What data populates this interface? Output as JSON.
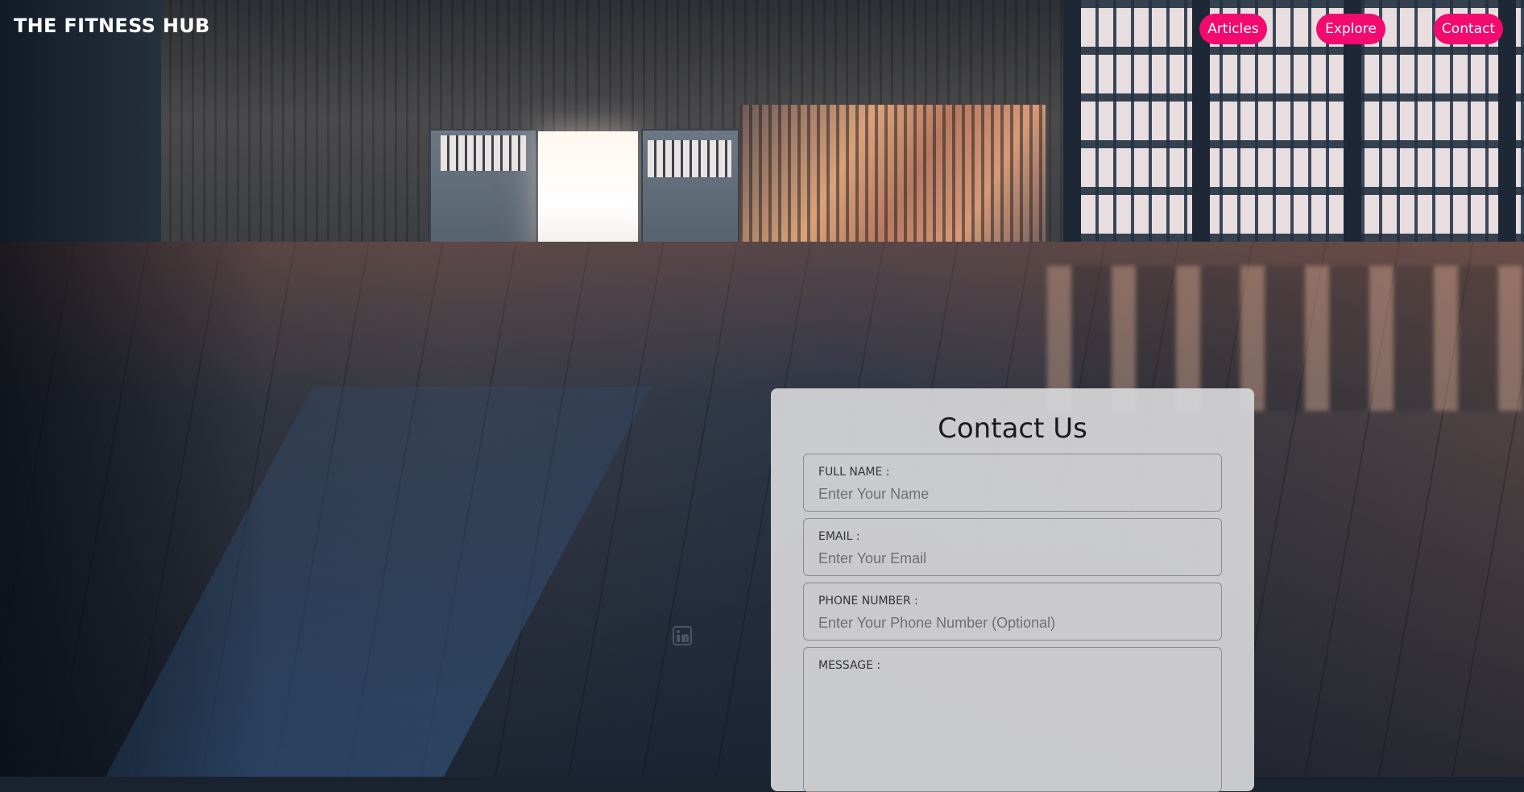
{
  "header": {
    "brand": "THE FITNESS HUB",
    "nav": [
      {
        "label": "Articles"
      },
      {
        "label": "Explore"
      },
      {
        "label": "Contact"
      }
    ],
    "accent_color": "#f20a6f"
  },
  "contact_form": {
    "title": "Contact Us",
    "fields": {
      "full_name": {
        "label": "FULL NAME :",
        "placeholder": "Enter Your Name",
        "value": ""
      },
      "email": {
        "label": "EMAIL :",
        "placeholder": "Enter Your Email",
        "value": ""
      },
      "phone": {
        "label": "PHONE NUMBER :",
        "placeholder": "Enter Your Phone Number (Optional)",
        "value": ""
      },
      "message": {
        "label": "MESSAGE :",
        "placeholder": "",
        "value": ""
      }
    }
  },
  "social": {
    "icon": "linkedin-icon"
  }
}
